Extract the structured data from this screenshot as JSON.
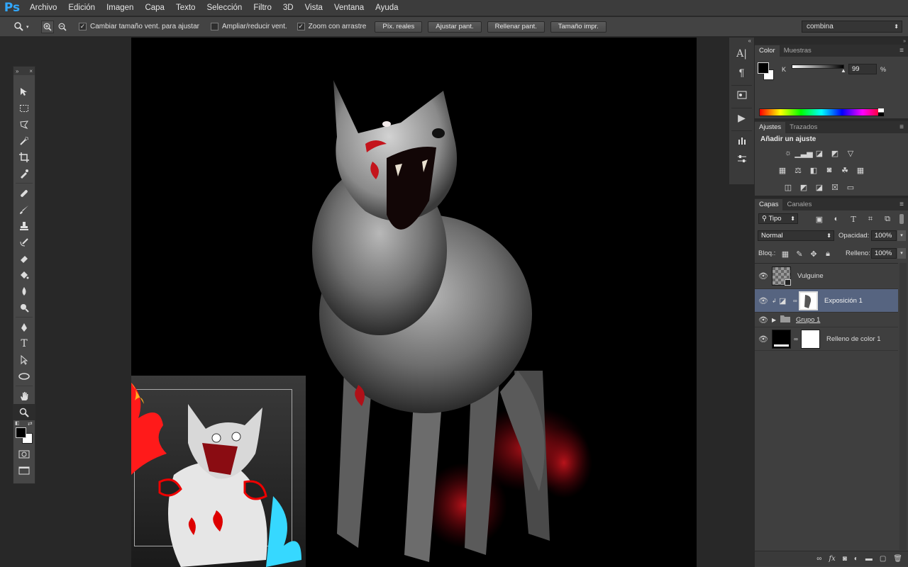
{
  "app": {
    "logo": "Ps"
  },
  "menu": [
    "Archivo",
    "Edición",
    "Imagen",
    "Capa",
    "Texto",
    "Selección",
    "Filtro",
    "3D",
    "Vista",
    "Ventana",
    "Ayuda"
  ],
  "options": {
    "resize_windows_label": "Cambiar tamaño vent. para ajustar",
    "resize_windows_checked": true,
    "zoom_all_label": "Ampliar/reducir vent.",
    "zoom_all_checked": false,
    "scrubby_zoom_label": "Zoom con arrastre",
    "scrubby_zoom_checked": true,
    "actual_pixels": "Píx. reales",
    "fit_screen": "Ajustar pant.",
    "fill_screen": "Rellenar pant.",
    "print_size": "Tamaño impr.",
    "workspace": "combina"
  },
  "color_panel": {
    "tabs": [
      "Color",
      "Muestras"
    ],
    "channel_label": "K",
    "value": "99",
    "unit": "%",
    "foreground": "#000000",
    "background": "#ffffff"
  },
  "adjust_panel": {
    "tabs": [
      "Ajustes",
      "Trazados"
    ],
    "title": "Añadir un ajuste"
  },
  "layers_panel": {
    "tabs": [
      "Capas",
      "Canales"
    ],
    "filter_label": "Tipo",
    "blend_mode": "Normal",
    "opacity_label": "Opacidad:",
    "opacity": "100%",
    "lock_label": "Bloq.:",
    "fill_label": "Relleno:",
    "fill": "100%",
    "layers": [
      {
        "name": "Vulguine",
        "selected": false
      },
      {
        "name": "Exposición 1",
        "selected": true
      },
      {
        "name": "Grupo 1",
        "selected": false
      },
      {
        "name": "Relleno de color 1",
        "selected": false
      }
    ]
  },
  "colors": {
    "accent_blue": "#31a8ff",
    "selected_layer": "#566480",
    "blood_red": "#d4141c"
  }
}
